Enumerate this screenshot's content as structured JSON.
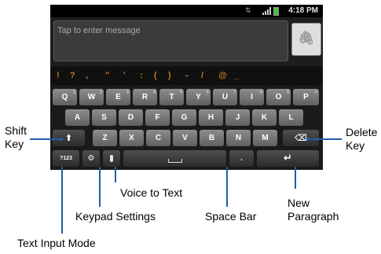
{
  "status_bar": {
    "time": "4:18 PM"
  },
  "message_field": {
    "placeholder": "Tap to enter message"
  },
  "symbols": [
    "!",
    "?",
    ",",
    "\"",
    "'",
    ":",
    "(",
    ")",
    "-",
    "/",
    "@",
    "_"
  ],
  "keyboard": {
    "row1": [
      "Q",
      "W",
      "E",
      "R",
      "T",
      "Y",
      "U",
      "I",
      "O",
      "P"
    ],
    "row1_sup": [
      "1",
      "2",
      "3",
      "4",
      "5",
      "6",
      "7",
      "8",
      "9",
      "0"
    ],
    "row2": [
      "A",
      "S",
      "D",
      "F",
      "G",
      "H",
      "J",
      "K",
      "L"
    ],
    "row3": [
      "Z",
      "X",
      "C",
      "V",
      "B",
      "N",
      "M"
    ],
    "mode_label": "?123",
    "period_label": "."
  },
  "annotations": {
    "shift_key": "Shift\nKey",
    "delete_key": "Delete\nKey",
    "voice_to_text": "Voice to Text",
    "keypad_settings": "Keypad Settings",
    "space_bar": "Space Bar",
    "new_paragraph": "New\nParagraph",
    "text_input_mode": "Text Input Mode"
  },
  "colors": {
    "callout_line": "#1d5fa8",
    "symbol_text": "#c8781e"
  }
}
